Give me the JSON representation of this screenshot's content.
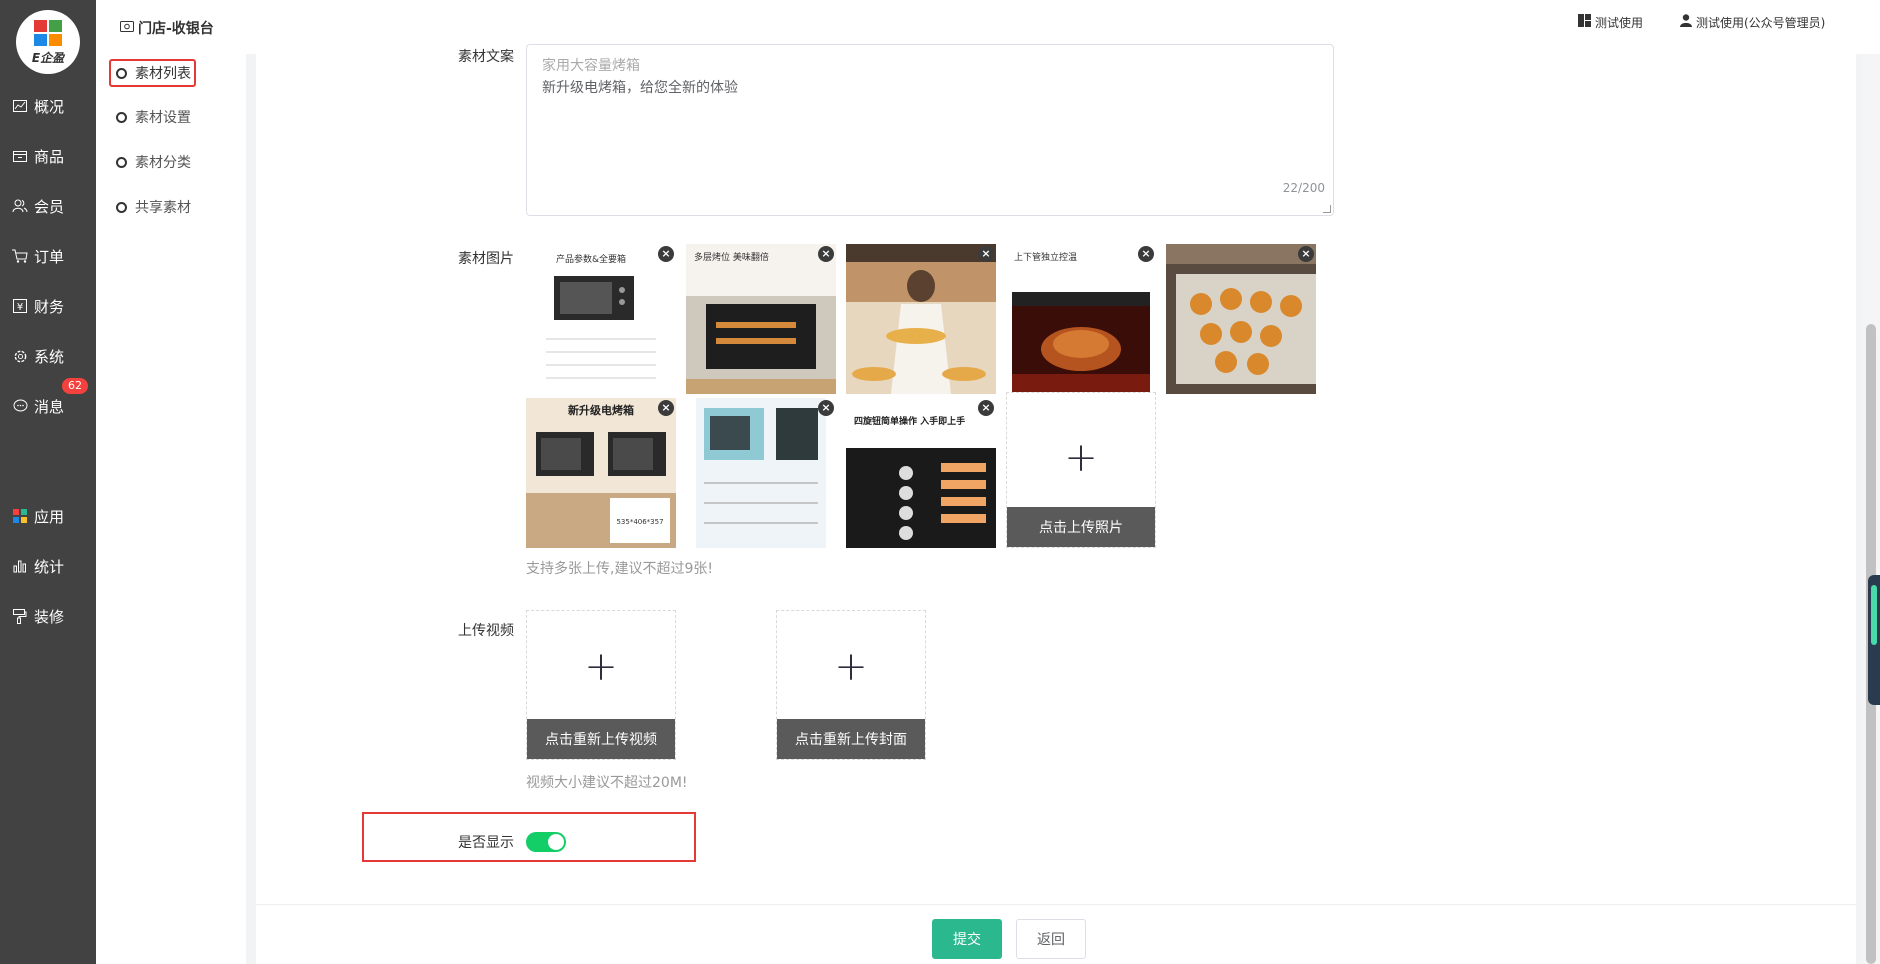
{
  "logo": {
    "text": "E企盈"
  },
  "nav": {
    "items": [
      {
        "label": "概况",
        "icon": "chart-line-icon"
      },
      {
        "label": "商品",
        "icon": "box-icon"
      },
      {
        "label": "会员",
        "icon": "users-icon"
      },
      {
        "label": "订单",
        "icon": "cart-icon"
      },
      {
        "label": "财务",
        "icon": "finance-icon"
      },
      {
        "label": "系统",
        "icon": "gear-icon"
      },
      {
        "label": "消息",
        "icon": "message-icon",
        "badge": "62"
      },
      {
        "label": "应用",
        "icon": "apps-icon"
      },
      {
        "label": "统计",
        "icon": "bar-chart-icon"
      },
      {
        "label": "装修",
        "icon": "paint-roller-icon"
      }
    ]
  },
  "topbar": {
    "store": "门店-收银台",
    "account1": "测试使用",
    "account2": "测试使用(公众号管理员)"
  },
  "subnav": {
    "items": [
      "素材列表",
      "素材设置",
      "素材分类",
      "共享素材"
    ],
    "active": "素材列表"
  },
  "form": {
    "copy_label": "素材文案",
    "copy_line1": "家用大容量烤箱",
    "copy_line2": "新升级电烤箱，给您全新的体验",
    "copy_counter": "22/200",
    "images_label": "素材图片",
    "upload_photo": "点击上传照片",
    "images_hint": "支持多张上传,建议不超过9张!",
    "video_label": "上传视频",
    "reupload_video": "点击重新上传视频",
    "reupload_cover": "点击重新上传封面",
    "video_hint": "视频大小建议不超过20M!",
    "show_label": "是否显示",
    "show_enabled": true
  },
  "images": [
    {
      "name": "oven-spec-sheet",
      "caption": "产品参数&全要箱"
    },
    {
      "name": "oven-multi-layer",
      "caption": "多层烤位 美味翻倍"
    },
    {
      "name": "woman-serving-tarts",
      "caption": ""
    },
    {
      "name": "roast-chicken-oven",
      "caption": "上下管独立控温"
    },
    {
      "name": "baked-puffs-tray",
      "caption": ""
    },
    {
      "name": "upgraded-oven-compare",
      "caption": "新升级电烤箱"
    },
    {
      "name": "blue-oven-specs",
      "caption": ""
    },
    {
      "name": "four-knob-control",
      "caption": "四旋钮简单操作 入手即上手"
    }
  ],
  "footer": {
    "submit": "提交",
    "back": "返回"
  },
  "colors": {
    "primary": "#2bb88e",
    "toggle_on": "#13ce66",
    "highlight_border": "#e53935",
    "sidebar": "#424242"
  }
}
